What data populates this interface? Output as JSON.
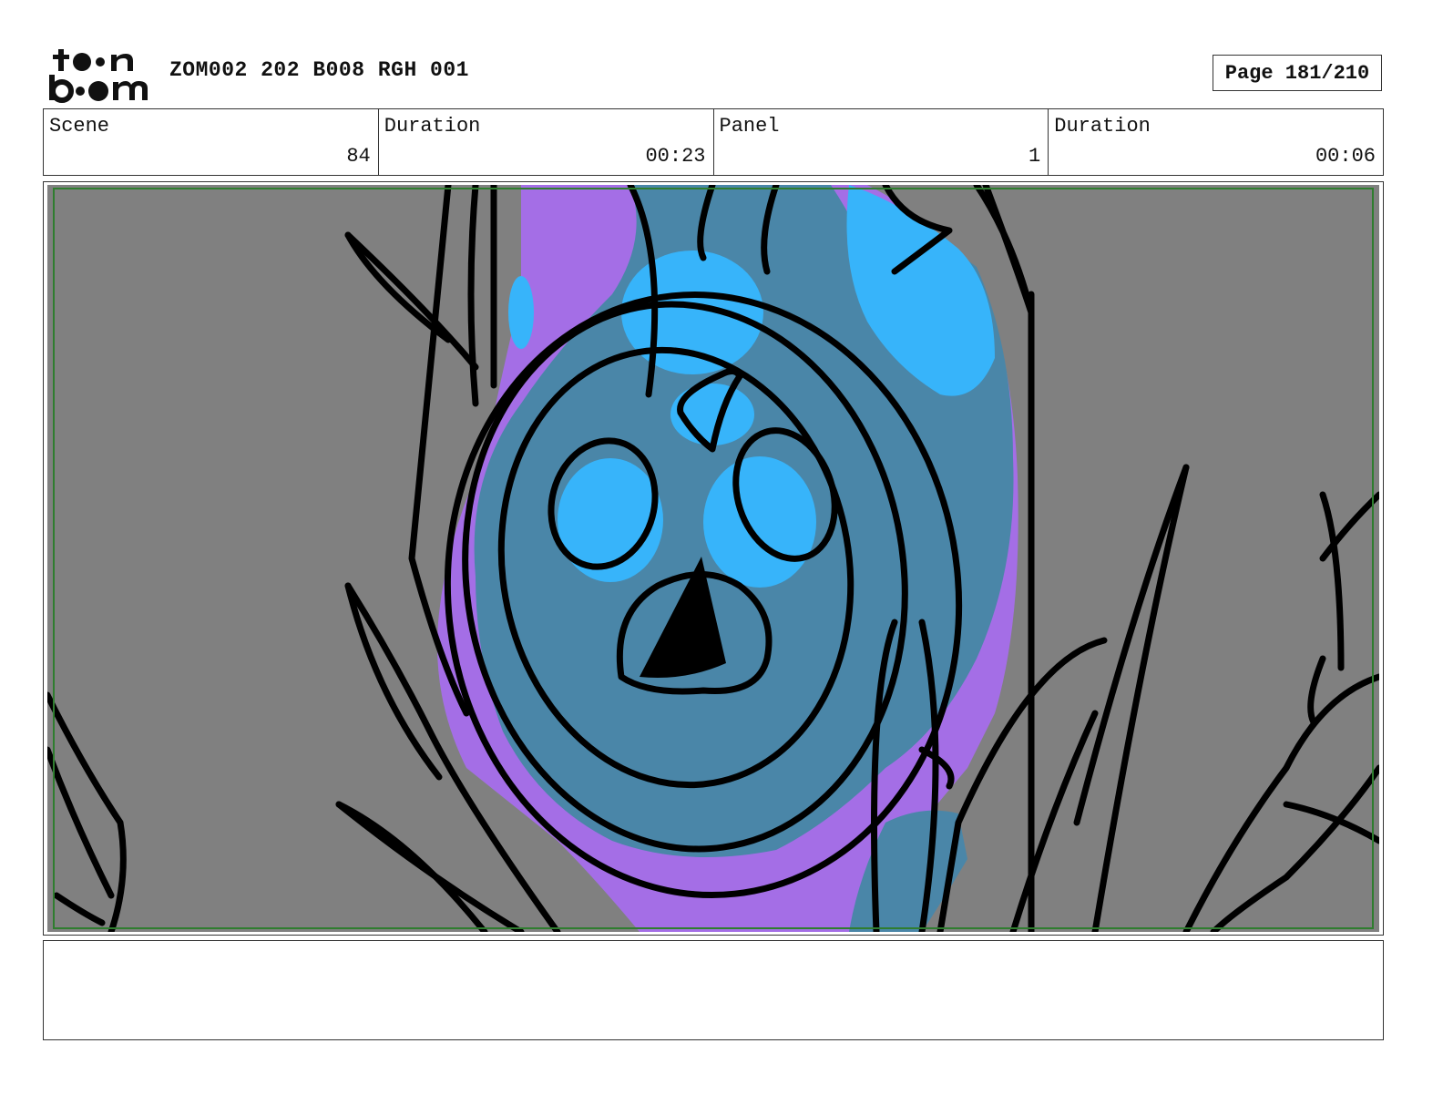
{
  "header": {
    "logo": {
      "line1": "toon",
      "line2": "boom",
      "icon": "toonboom-logo"
    },
    "document_title": "ZOM002 202 B008 RGH 001",
    "page_label": "Page 181/210"
  },
  "info": [
    {
      "label": "Scene",
      "value": "84"
    },
    {
      "label": "Duration",
      "value": "00:23"
    },
    {
      "label": "Panel",
      "value": "1"
    },
    {
      "label": "Duration",
      "value": "00:06"
    }
  ],
  "panel": {
    "icon": "storyboard-sketch-creature-face",
    "colors": {
      "background": "#808080",
      "body": "#4a86a8",
      "highlight": "#37b4fa",
      "glow": "#a46ee6",
      "safe_frame": "#2f7d2f"
    }
  },
  "notes": {
    "text": ""
  }
}
